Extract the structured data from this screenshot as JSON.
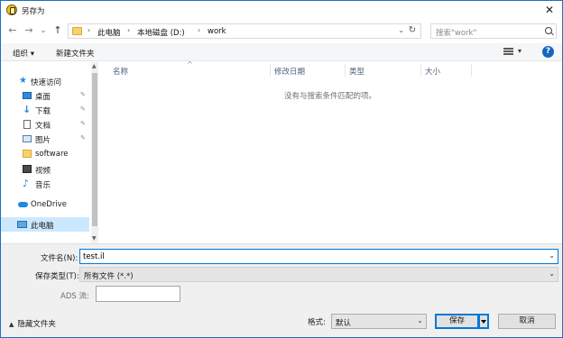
{
  "window": {
    "title": "另存为",
    "close_glyph": "✕"
  },
  "nav": {
    "back_glyph": "←",
    "forward_glyph": "→",
    "recent_glyph": "⌄",
    "up_glyph": "↑"
  },
  "address": {
    "parts": [
      "此电脑",
      "本地磁盘 (D:)",
      "work"
    ],
    "separator": "›",
    "dropdown_glyph": "⌄",
    "refresh_glyph": "↻"
  },
  "search": {
    "placeholder": "搜索\"work\""
  },
  "toolbar": {
    "organize_label": "组织 ▾",
    "new_folder_label": "新建文件夹",
    "view_dropdown_glyph": "▾",
    "help_glyph": "?"
  },
  "sidebar": {
    "items": [
      {
        "label": "快速访问",
        "icon": "star-icon"
      },
      {
        "label": "桌面",
        "icon": "desktop-icon",
        "pinned": true
      },
      {
        "label": "下载",
        "icon": "download-icon",
        "pinned": true
      },
      {
        "label": "文档",
        "icon": "document-icon",
        "pinned": true
      },
      {
        "label": "图片",
        "icon": "picture-icon",
        "pinned": true
      },
      {
        "label": "software",
        "icon": "folder-icon"
      },
      {
        "label": "视频",
        "icon": "video-icon"
      },
      {
        "label": "音乐",
        "icon": "music-icon"
      },
      {
        "label": "OneDrive",
        "icon": "cloud-icon"
      },
      {
        "label": "此电脑",
        "icon": "computer-icon",
        "selected": true
      }
    ],
    "pin_glyph": "📌"
  },
  "filelist": {
    "columns": [
      "名称",
      "修改日期",
      "类型",
      "大小"
    ],
    "empty_message": "没有与搜索条件匹配的项。"
  },
  "form": {
    "filename_label": "文件名(N):",
    "filename_value": "test.il",
    "filetype_label": "保存类型(T):",
    "filetype_value": "所有文件 (*.*)",
    "ads_label": "ADS 流:"
  },
  "footer": {
    "hide_folders_label": "隐藏文件夹",
    "encoding_label": "格式:",
    "encoding_value": "默认",
    "save_label": "保存",
    "cancel_label": "取消"
  },
  "colors": {
    "accent": "#0078d7",
    "selected_bg": "#cce8ff",
    "panel_bg": "#f0f0f0"
  }
}
